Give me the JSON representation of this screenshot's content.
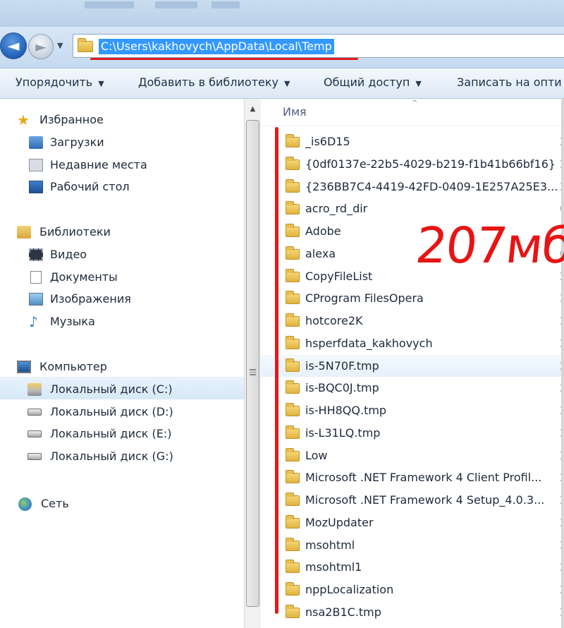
{
  "navigation": {
    "back_glyph": "◄",
    "forward_glyph": "►",
    "history_glyph": "▼",
    "address_path": "C:\\Users\\kakhovych\\AppData\\Local\\Temp"
  },
  "toolbar": {
    "items": [
      {
        "label": "Упорядочить",
        "caret": "▼"
      },
      {
        "label": "Добавить в библиотеку",
        "caret": "▼"
      },
      {
        "label": "Общий доступ",
        "caret": "▼"
      },
      {
        "label": "Записать на опти"
      }
    ]
  },
  "sidebar": {
    "favorites": {
      "label": "Избранное",
      "icon": "star-icon",
      "items": [
        {
          "label": "Загрузки",
          "icon": "downloads-icon"
        },
        {
          "label": "Недавние места",
          "icon": "recent-places-icon"
        },
        {
          "label": "Рабочий стол",
          "icon": "desktop-icon"
        }
      ]
    },
    "libraries": {
      "label": "Библиотеки",
      "icon": "libraries-icon",
      "items": [
        {
          "label": "Видео",
          "icon": "video-icon"
        },
        {
          "label": "Документы",
          "icon": "documents-icon"
        },
        {
          "label": "Изображения",
          "icon": "pictures-icon"
        },
        {
          "label": "Музыка",
          "icon": "music-icon"
        }
      ]
    },
    "computer": {
      "label": "Компьютер",
      "icon": "computer-icon",
      "items": [
        {
          "label": "Локальный диск (C:)",
          "icon": "drive-c-icon",
          "selected": true
        },
        {
          "label": "Локальный диск (D:)",
          "icon": "drive-icon"
        },
        {
          "label": "Локальный диск (E:)",
          "icon": "drive-icon"
        },
        {
          "label": "Локальный диск (G:)",
          "icon": "drive-icon"
        }
      ]
    },
    "network": {
      "label": "Сеть",
      "icon": "network-icon"
    },
    "scroll_up_glyph": "▲"
  },
  "file_list": {
    "column_name": "Имя",
    "sort_glyph": "^",
    "files": [
      {
        "name": "_is6D15",
        "date": "2"
      },
      {
        "name": "{0df0137e-22b5-4029-b219-f1b41b66bf16}",
        "date": "2"
      },
      {
        "name": "{236BB7C4-4419-42FD-0409-1E257A25E3...",
        "date": "2"
      },
      {
        "name": "acro_rd_dir",
        "date": "0"
      },
      {
        "name": "Adobe",
        "date": "2"
      },
      {
        "name": "alexa",
        "date": "0"
      },
      {
        "name": "CopyFileList",
        "date": "2"
      },
      {
        "name": "CProgram FilesOpera",
        "date": "2"
      },
      {
        "name": "hotcore2K",
        "date": "2"
      },
      {
        "name": "hsperfdata_kakhovych",
        "date": "2"
      },
      {
        "name": "is-5N70F.tmp",
        "date": "2"
      },
      {
        "name": "is-BQC0J.tmp",
        "date": "2"
      },
      {
        "name": "is-HH8QQ.tmp",
        "date": "2"
      },
      {
        "name": "is-L31LQ.tmp",
        "date": "2"
      },
      {
        "name": "Low",
        "date": "2"
      },
      {
        "name": "Microsoft .NET Framework 4 Client Profil...",
        "date": "2"
      },
      {
        "name": "Microsoft .NET Framework 4 Setup_4.0.3...",
        "date": "2"
      },
      {
        "name": "MozUpdater",
        "date": "2"
      },
      {
        "name": "msohtml",
        "date": "2"
      },
      {
        "name": "msohtml1",
        "date": "2"
      },
      {
        "name": "nppLocalization",
        "date": "2"
      },
      {
        "name": "nsa2B1C.tmp",
        "date": "2"
      }
    ]
  },
  "annotation": {
    "text": "207мб",
    "color": "#e81414"
  },
  "colors": {
    "selection_blue": "#3399ff",
    "annotation_red": "#e01b1b",
    "toolbar_text": "#1e3048"
  }
}
